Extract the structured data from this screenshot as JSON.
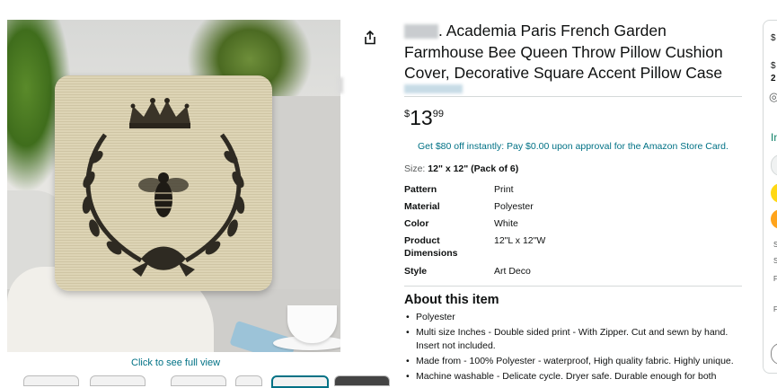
{
  "product": {
    "brand_blurred": true,
    "title": ". Academia Paris French Garden Farmhouse Bee Queen Throw Pillow Cushion Cover, Decorative Square Accent Pillow Case",
    "price": {
      "symbol": "$",
      "whole": "13",
      "fraction": "99"
    },
    "promo": "Get $80 off instantly: Pay $0.00 upon approval for the Amazon Store Card.",
    "size_label": "Size: ",
    "size_value": "12\" x 12\" (Pack of 6)",
    "specs": [
      {
        "key": "Pattern",
        "value": "Print"
      },
      {
        "key": "Material",
        "value": "Polyester"
      },
      {
        "key": "Color",
        "value": "White"
      },
      {
        "key": "Product Dimensions",
        "value": "12\"L x 12\"W"
      },
      {
        "key": "Style",
        "value": "Art Deco"
      }
    ],
    "about_heading": "About this item",
    "bullets": [
      "Polyester",
      "Multi size Inches - Double sided print - With Zipper. Cut and sewn by hand. Insert not included.",
      "Made from - 100% Polyester - waterproof, High quality fabric. Highly unique.",
      "Machine washable - Delicate cycle. Dryer safe. Durable enough for both"
    ]
  },
  "gallery": {
    "view_link": "Click to see full view"
  },
  "icons": {
    "share": "share-icon"
  },
  "buybox": {
    "line1": "$",
    "line2": "$",
    "line3": "2",
    "line4": "In"
  },
  "colors": {
    "link": "#007185",
    "buy_yellow": "#ffd814",
    "buy_orange": "#ffa41c"
  }
}
